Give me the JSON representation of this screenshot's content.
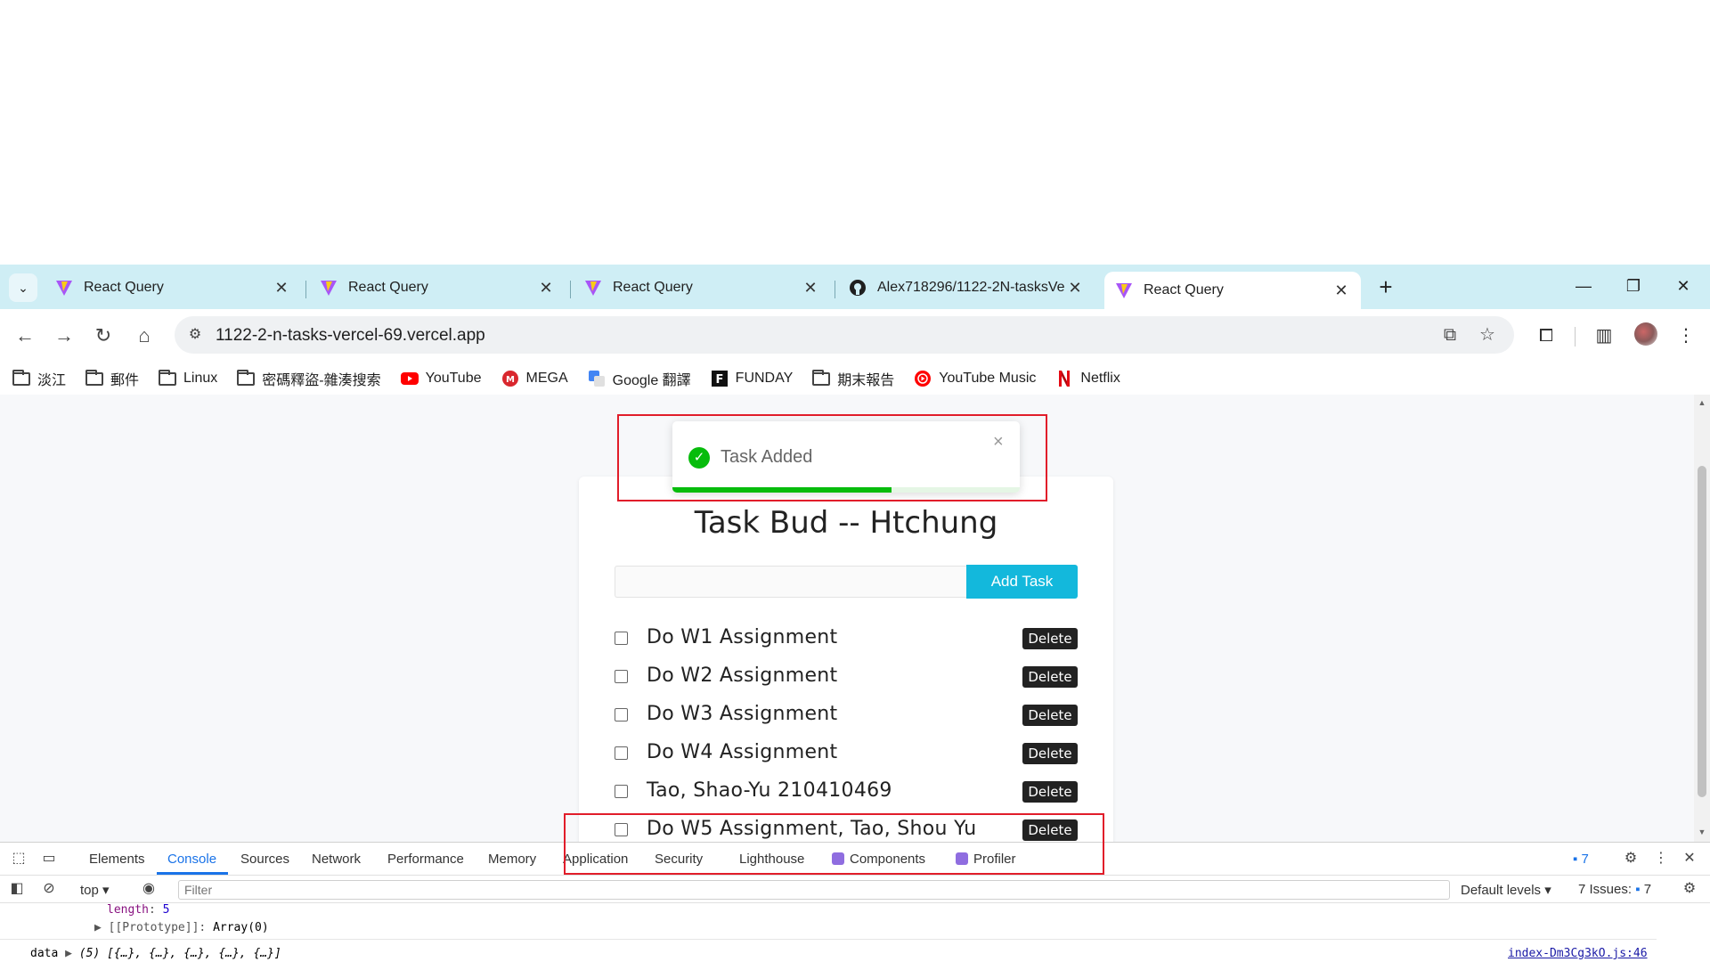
{
  "browser": {
    "tabs": [
      {
        "title": "React Query",
        "favicon": "vite-logo-icon",
        "active": false
      },
      {
        "title": "React Query",
        "favicon": "vite-logo-icon",
        "active": false
      },
      {
        "title": "React Query",
        "favicon": "vite-logo-icon",
        "active": false
      },
      {
        "title": "Alex718296/1122-2N-tasksVe",
        "favicon": "github-icon",
        "active": false
      },
      {
        "title": "React Query",
        "favicon": "vite-logo-icon",
        "active": true
      }
    ],
    "new_tab": "+",
    "url": "1122-2-n-tasks-vercel-69.vercel.app",
    "bookmarks": [
      {
        "label": "淡江",
        "icon": "folder-icon"
      },
      {
        "label": "郵件",
        "icon": "folder-icon"
      },
      {
        "label": "Linux",
        "icon": "folder-icon"
      },
      {
        "label": "密碼釋盜-雜湊搜索",
        "icon": "folder-icon"
      },
      {
        "label": "YouTube",
        "icon": "youtube-icon"
      },
      {
        "label": "MEGA",
        "icon": "mega-icon"
      },
      {
        "label": "Google 翻譯",
        "icon": "google-translate-icon"
      },
      {
        "label": "FUNDAY",
        "icon": "funday-icon"
      },
      {
        "label": "期末報告",
        "icon": "folder-icon"
      },
      {
        "label": "YouTube Music",
        "icon": "youtube-music-icon"
      },
      {
        "label": "Netflix",
        "icon": "netflix-icon"
      }
    ]
  },
  "app": {
    "title": "Task Bud -- Htchung",
    "input_value": "",
    "add_button": "Add Task",
    "delete_label": "Delete",
    "tasks": [
      {
        "text": "Do W1 Assignment",
        "done": false
      },
      {
        "text": "Do W2 Assignment",
        "done": false
      },
      {
        "text": "Do W3 Assignment",
        "done": false
      },
      {
        "text": "Do W4 Assignment",
        "done": false
      },
      {
        "text": "Tao, Shao-Yu 210410469",
        "done": false
      },
      {
        "text": "Do W5 Assignment, Tao, Shou Yu",
        "done": false
      }
    ]
  },
  "toast": {
    "message": "Task Added",
    "close": "×",
    "progress": 0.63,
    "color": "#07bc0c"
  },
  "devtools": {
    "tabs": [
      {
        "label": "Elements",
        "active": false
      },
      {
        "label": "Console",
        "active": true
      },
      {
        "label": "Sources",
        "active": false
      },
      {
        "label": "Network",
        "active": false
      },
      {
        "label": "Performance",
        "active": false
      },
      {
        "label": "Memory",
        "active": false
      },
      {
        "label": "Application",
        "active": false
      },
      {
        "label": "Security",
        "active": false
      },
      {
        "label": "Lighthouse",
        "active": false
      },
      {
        "label": "Components",
        "active": false
      },
      {
        "label": "Profiler",
        "active": false
      }
    ],
    "message_count": "7",
    "context": "top",
    "filter_placeholder": "Filter",
    "levels": "Default levels ▾",
    "issues_label": "7 Issues:",
    "issues_count": "7",
    "console": {
      "length_key": "length",
      "length_value": "5",
      "prototype_key": "[[Prototype]]",
      "prototype_value": "Array(0)",
      "data_label": "data",
      "data_value": "(5) [{…}, {…}, {…}, {…}, {…}]",
      "source_link": "index-Dm3Cg3kO.js:46"
    }
  },
  "colors": {
    "tabstrip": "#cfeef5",
    "accent": "#13b8dc",
    "highlight": "#e11d2a"
  }
}
